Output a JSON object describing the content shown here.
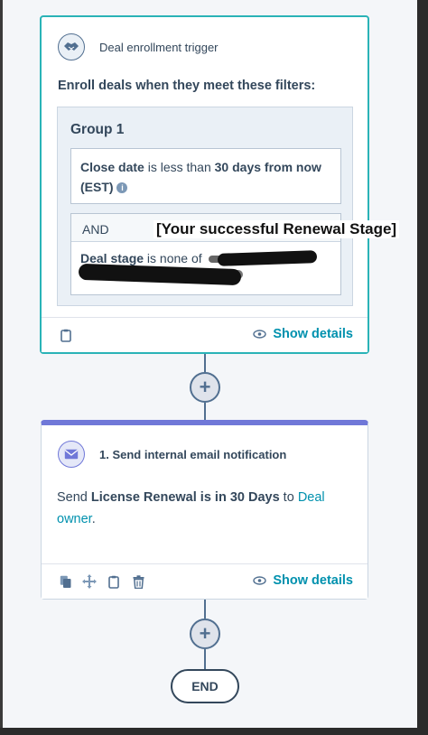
{
  "trigger": {
    "title": "Deal enrollment trigger",
    "icon": "handshake-icon",
    "enroll_text": "Enroll deals when they meet these filters:",
    "group": {
      "title": "Group 1",
      "filter1": {
        "property": "Close date",
        "operator": " is less than ",
        "value": "30 days from now (EST)"
      },
      "and_label": "AND",
      "filter2": {
        "property": "Deal stage",
        "operator": " is none of ",
        "value_redacted": "[redacted]"
      }
    },
    "show_details": "Show details"
  },
  "annotation": {
    "callout": "[Your successful Renewal Stage]"
  },
  "action": {
    "title": "1. Send internal email notification",
    "icon": "envelope-icon",
    "text_prefix": "Send ",
    "email_name": "License Renewal is in 30 Days",
    "text_mid": " to ",
    "recipient": "Deal owner",
    "text_suffix": ".",
    "show_details": "Show details"
  },
  "plus_symbol": "+",
  "end_label": "END",
  "colors": {
    "teal_border": "#2ab3b7",
    "accent_purple": "#7078d8",
    "link": "#0091ae",
    "text": "#33475b"
  }
}
